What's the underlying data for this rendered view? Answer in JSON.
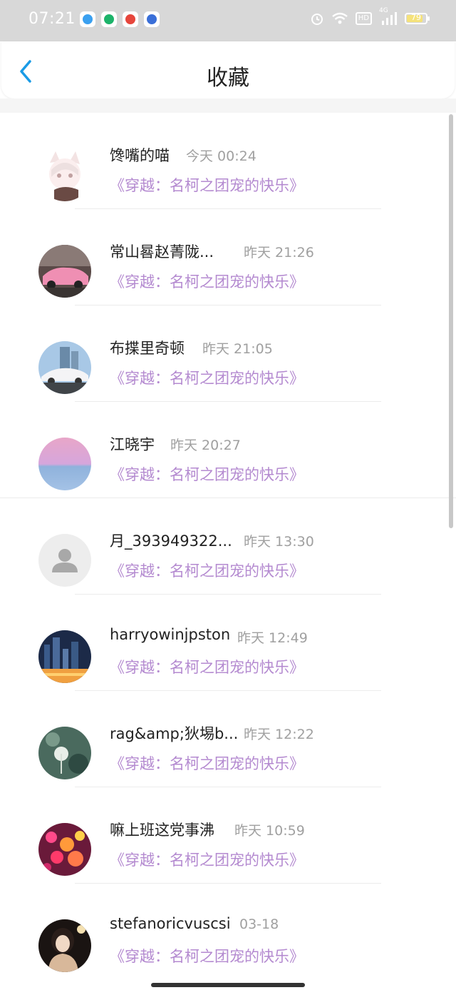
{
  "status_bar": {
    "time": "07:21",
    "battery": "79",
    "network": "4G",
    "hd": "HD"
  },
  "header": {
    "title": "收藏"
  },
  "items": [
    {
      "name": "馋嘴的喵",
      "time": "今天 00:24",
      "book": "《穿越：名柯之团宠的快乐》"
    },
    {
      "name": "常山晷赵菁陇...",
      "time": "昨天 21:26",
      "book": "《穿越：名柯之团宠的快乐》"
    },
    {
      "name": "布揲里奇顿",
      "time": "昨天 21:05",
      "book": "《穿越：名柯之团宠的快乐》"
    },
    {
      "name": "江晓宇",
      "time": "昨天 20:27",
      "book": "《穿越：名柯之团宠的快乐》"
    },
    {
      "name": "月_393949322...",
      "time": "昨天 13:30",
      "book": "《穿越：名柯之团宠的快乐》"
    },
    {
      "name": "harryowinjpston",
      "time": "昨天 12:49",
      "book": "《穿越：名柯之团宠的快乐》"
    },
    {
      "name": "rag&amp;狄埸b...",
      "time": "昨天 12:22",
      "book": "《穿越：名柯之团宠的快乐》"
    },
    {
      "name": "嘛上班这党事沸",
      "time": "昨天 10:59",
      "book": "《穿越：名柯之团宠的快乐》"
    },
    {
      "name": "stefanoricvuscsi",
      "time": "03-18",
      "book": "《穿越：名柯之团宠的快乐》"
    }
  ],
  "colors": {
    "accent_blue": "#1a9be6",
    "book_purple": "#b48ad0",
    "status_bar_bg": "#d8d8d8"
  }
}
